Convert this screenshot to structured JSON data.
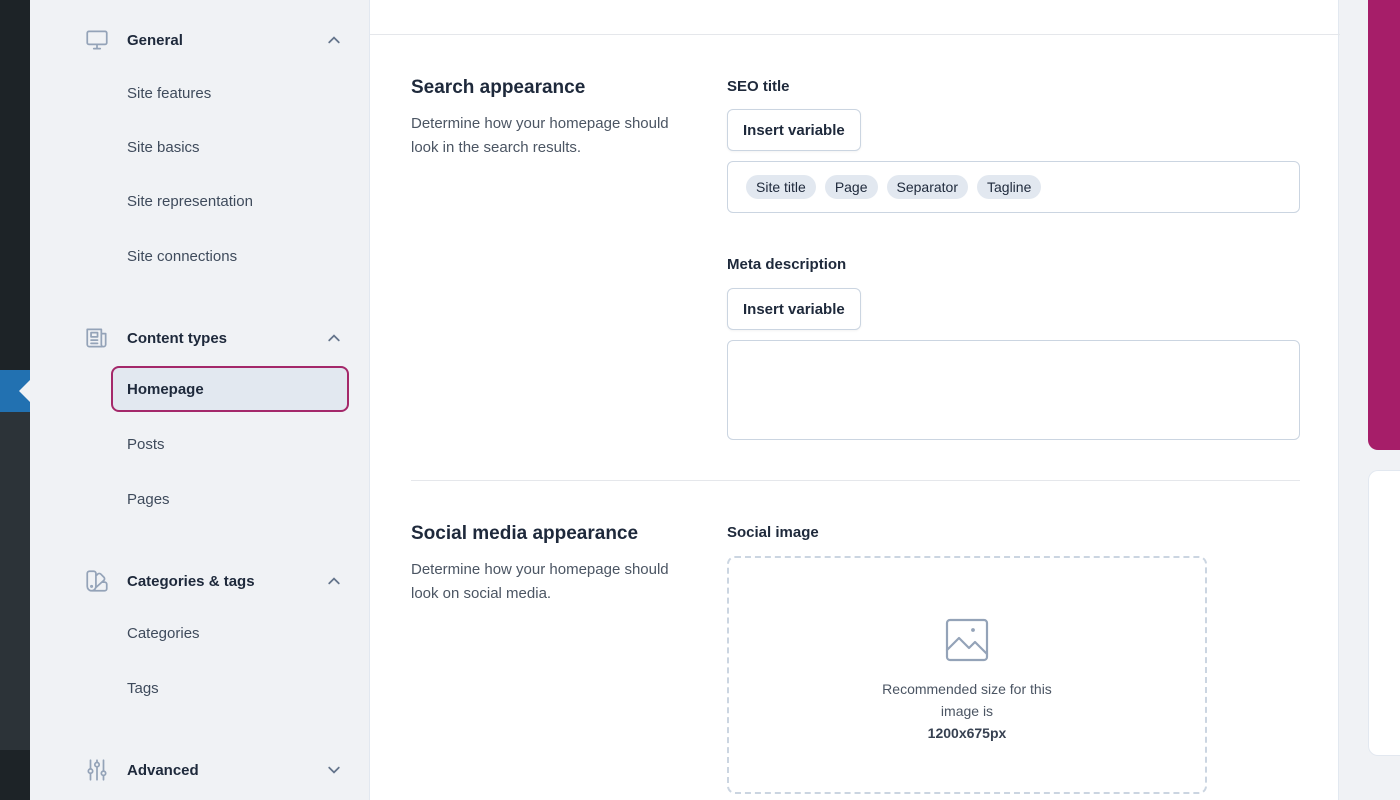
{
  "sidebar": {
    "groups": [
      {
        "label": "General",
        "icon": "desktop-icon",
        "expanded": true,
        "items": [
          "Site features",
          "Site basics",
          "Site representation",
          "Site connections"
        ]
      },
      {
        "label": "Content types",
        "icon": "newspaper-icon",
        "expanded": true,
        "items": [
          "Homepage",
          "Posts",
          "Pages"
        ]
      },
      {
        "label": "Categories & tags",
        "icon": "color-swatch-icon",
        "expanded": true,
        "items": [
          "Categories",
          "Tags"
        ]
      },
      {
        "label": "Advanced",
        "icon": "adjustments-icon",
        "expanded": false,
        "items": []
      }
    ],
    "selected_item": "Homepage"
  },
  "search_appearance": {
    "title": "Search appearance",
    "description": "Determine how your homepage should look in the search results.",
    "seo_title_label": "SEO title",
    "insert_variable_label": "Insert variable",
    "seo_title_variables": [
      "Site title",
      "Page",
      "Separator",
      "Tagline"
    ],
    "meta_description_label": "Meta description",
    "meta_description_value": ""
  },
  "social_appearance": {
    "title": "Social media appearance",
    "description": "Determine how your homepage should look on social media.",
    "social_image_label": "Social image",
    "recommended_text": "Recommended size for this image is",
    "recommended_size": "1200x675px"
  },
  "colors": {
    "accent": "#a61e69",
    "wp_admin_active": "#2271b1"
  }
}
